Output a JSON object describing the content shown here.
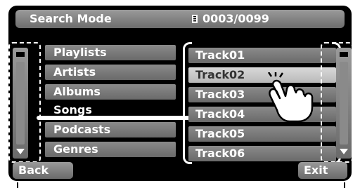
{
  "header": {
    "title": "Search Mode",
    "counter": "0003/0099",
    "icon": "file-icon"
  },
  "categories": [
    {
      "label": "Playlists",
      "selected": false
    },
    {
      "label": "Artists",
      "selected": false
    },
    {
      "label": "Albums",
      "selected": false
    },
    {
      "label": "Songs",
      "selected": true
    },
    {
      "label": "Podcasts",
      "selected": false
    },
    {
      "label": "Genres",
      "selected": false
    }
  ],
  "tracks": [
    {
      "label": "Track01",
      "selected": false
    },
    {
      "label": "Track02",
      "selected": true
    },
    {
      "label": "Track03",
      "selected": false
    },
    {
      "label": "Track04",
      "selected": false
    },
    {
      "label": "Track05",
      "selected": false
    },
    {
      "label": "Track06",
      "selected": false
    }
  ],
  "buttons": {
    "back": "Back",
    "exit": "Exit"
  }
}
